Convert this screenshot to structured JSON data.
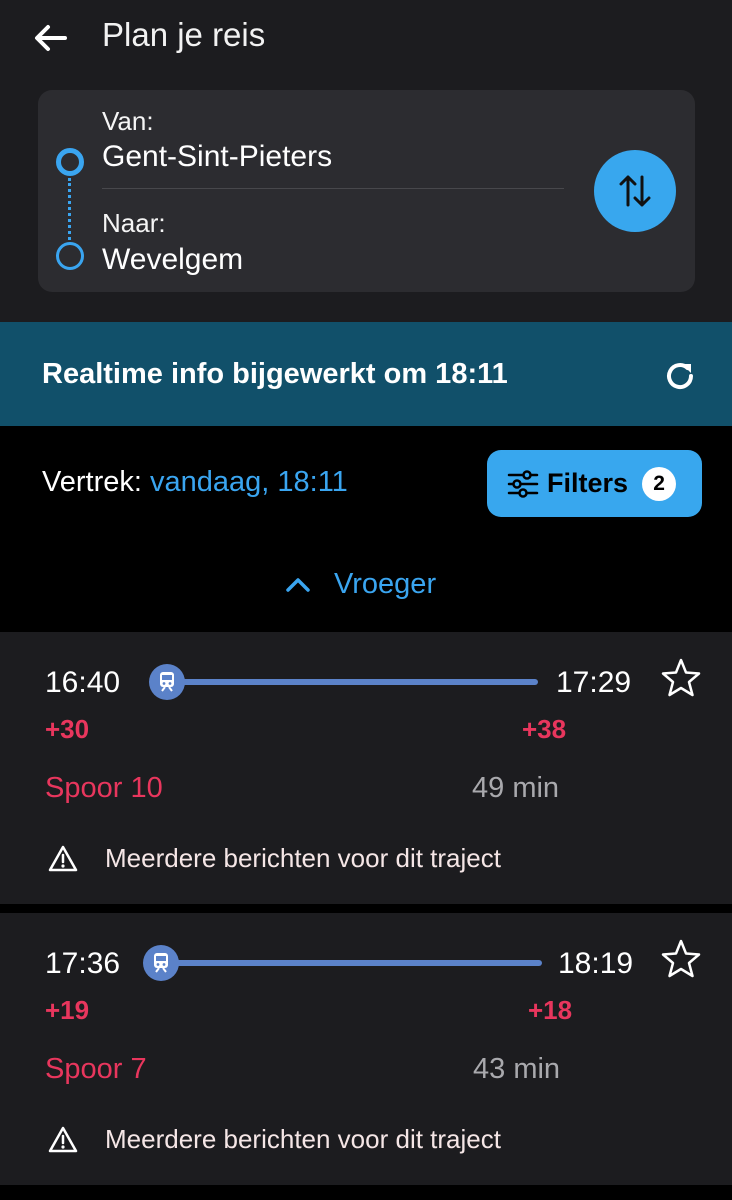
{
  "header": {
    "title": "Plan je reis"
  },
  "route": {
    "from_label": "Van:",
    "from_value": "Gent-Sint-Pieters",
    "to_label": "Naar:",
    "to_value": "Wevelgem"
  },
  "banner": {
    "text": "Realtime info bijgewerkt om 18:11"
  },
  "departure": {
    "label": "Vertrek:",
    "value": "vandaag, 18:11"
  },
  "filters": {
    "label": "Filters",
    "count": "2"
  },
  "earlier": {
    "label": "Vroeger"
  },
  "trips": [
    {
      "dep": "16:40",
      "arr": "17:29",
      "dep_delay": "+30",
      "arr_delay": "+38",
      "platform": "Spoor 10",
      "duration": "49 min",
      "message": "Meerdere berichten voor dit traject"
    },
    {
      "dep": "17:36",
      "arr": "18:19",
      "dep_delay": "+19",
      "arr_delay": "+18",
      "platform": "Spoor 7",
      "duration": "43 min",
      "message": "Meerdere berichten voor dit traject"
    }
  ],
  "colors": {
    "accent": "#38a7ee",
    "delay": "#e8365d",
    "banner": "#11506a",
    "line": "#5b82c9"
  },
  "icons": [
    "back-arrow-icon",
    "swap-icon",
    "refresh-icon",
    "filter-sliders-icon",
    "chevron-up-icon",
    "train-icon",
    "star-icon",
    "warning-icon"
  ]
}
